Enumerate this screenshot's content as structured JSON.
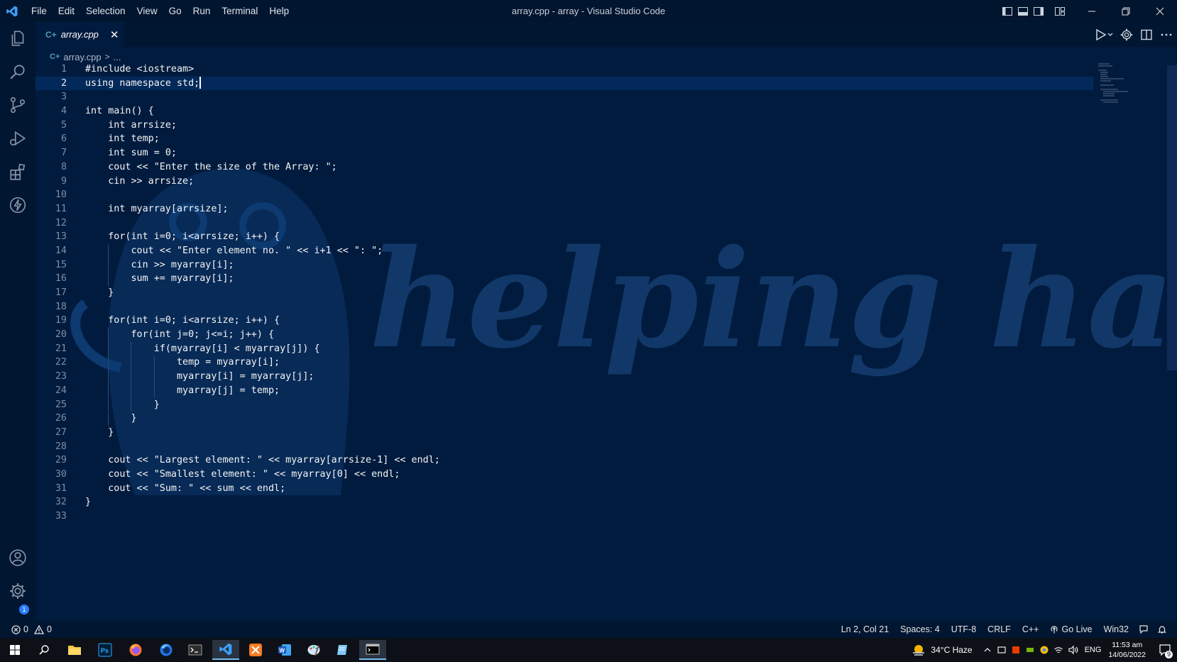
{
  "window": {
    "title": "array.cpp - array - Visual Studio Code",
    "menu": [
      "File",
      "Edit",
      "Selection",
      "View",
      "Go",
      "Run",
      "Terminal",
      "Help"
    ]
  },
  "tab": {
    "label": "array.cpp",
    "icon": "c++-file-icon"
  },
  "breadcrumb": {
    "file": "array.cpp",
    "separator": ">",
    "rest": "..."
  },
  "editor": {
    "watermark_text": "helping hand",
    "current_line": 2,
    "lines": [
      "#include <iostream>",
      "using namespace std;",
      "",
      "int main() {",
      "    int arrsize;",
      "    int temp;",
      "    int sum = 0;",
      "    cout << \"Enter the size of the Array: \";",
      "    cin >> arrsize;",
      "",
      "    int myarray[arrsize];",
      "",
      "    for(int i=0; i<arrsize; i++) {",
      "        cout << \"Enter element no. \" << i+1 << \": \";",
      "        cin >> myarray[i];",
      "        sum += myarray[i];",
      "    }",
      "",
      "    for(int i=0; i<arrsize; i++) {",
      "        for(int j=0; j<=i; j++) {",
      "            if(myarray[i] < myarray[j]) {",
      "                temp = myarray[i];",
      "                myarray[i] = myarray[j];",
      "                myarray[j] = temp;",
      "            }",
      "        }",
      "    }",
      "",
      "    cout << \"Largest element: \" << myarray[arrsize-1] << endl;",
      "    cout << \"Smallest element: \" << myarray[0] << endl;",
      "    cout << \"Sum: \" << sum << endl;",
      "}",
      ""
    ]
  },
  "statusbar": {
    "errors": "0",
    "warnings": "0",
    "position": "Ln 2, Col 21",
    "spaces": "Spaces: 4",
    "encoding": "UTF-8",
    "eol": "CRLF",
    "language": "C++",
    "go_live": "Go Live",
    "platform": "Win32"
  },
  "activity": {
    "accounts_badge": "1"
  },
  "taskbar": {
    "weather": "34°C  Haze",
    "language": "ENG",
    "time": "11:53 am",
    "date": "14/06/2022",
    "notifications": "9"
  },
  "colors": {
    "editor_bg": "#011b3e",
    "keyword": "#f5f5f5",
    "string": "#ffffff",
    "bracket_gold": "#ffd700",
    "bracket_pink": "#da70d6",
    "bracket_blue": "#179fff",
    "array_color": "#ff7ea8"
  }
}
